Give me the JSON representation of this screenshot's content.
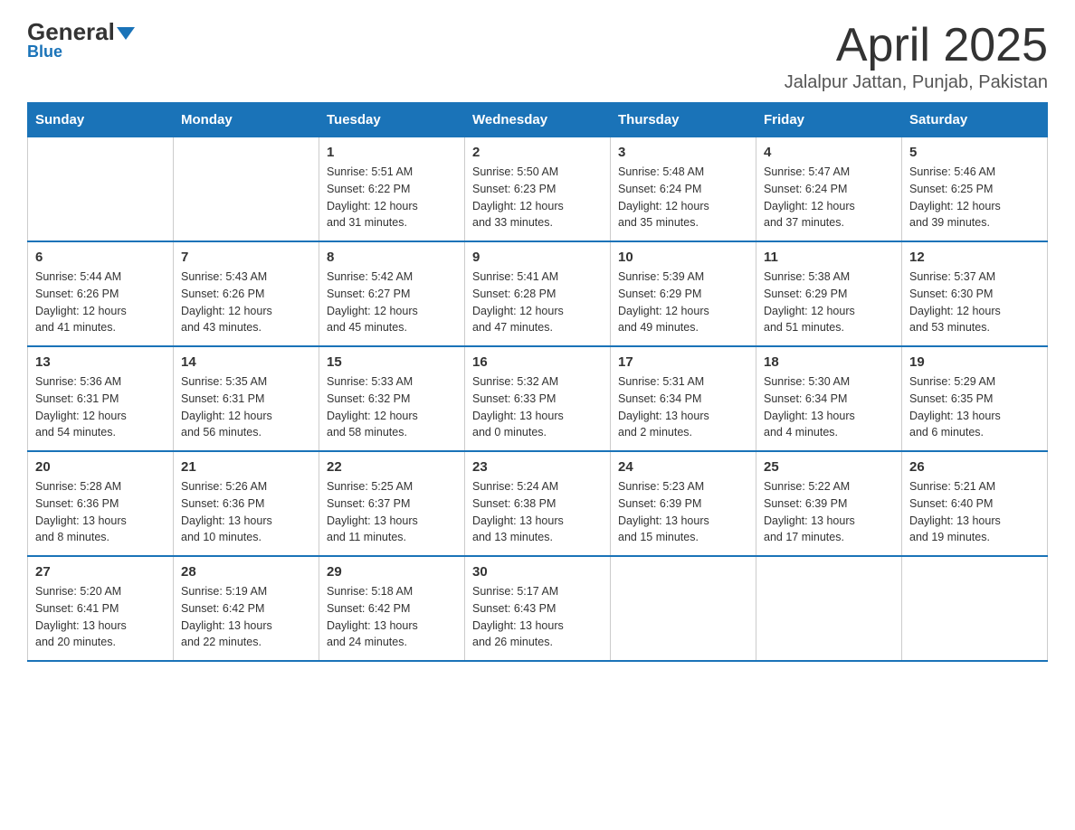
{
  "header": {
    "logo_general": "General",
    "logo_blue": "Blue",
    "month_title": "April 2025",
    "subtitle": "Jalalpur Jattan, Punjab, Pakistan"
  },
  "days_of_week": [
    "Sunday",
    "Monday",
    "Tuesday",
    "Wednesday",
    "Thursday",
    "Friday",
    "Saturday"
  ],
  "weeks": [
    [
      {
        "day": "",
        "info": ""
      },
      {
        "day": "",
        "info": ""
      },
      {
        "day": "1",
        "info": "Sunrise: 5:51 AM\nSunset: 6:22 PM\nDaylight: 12 hours\nand 31 minutes."
      },
      {
        "day": "2",
        "info": "Sunrise: 5:50 AM\nSunset: 6:23 PM\nDaylight: 12 hours\nand 33 minutes."
      },
      {
        "day": "3",
        "info": "Sunrise: 5:48 AM\nSunset: 6:24 PM\nDaylight: 12 hours\nand 35 minutes."
      },
      {
        "day": "4",
        "info": "Sunrise: 5:47 AM\nSunset: 6:24 PM\nDaylight: 12 hours\nand 37 minutes."
      },
      {
        "day": "5",
        "info": "Sunrise: 5:46 AM\nSunset: 6:25 PM\nDaylight: 12 hours\nand 39 minutes."
      }
    ],
    [
      {
        "day": "6",
        "info": "Sunrise: 5:44 AM\nSunset: 6:26 PM\nDaylight: 12 hours\nand 41 minutes."
      },
      {
        "day": "7",
        "info": "Sunrise: 5:43 AM\nSunset: 6:26 PM\nDaylight: 12 hours\nand 43 minutes."
      },
      {
        "day": "8",
        "info": "Sunrise: 5:42 AM\nSunset: 6:27 PM\nDaylight: 12 hours\nand 45 minutes."
      },
      {
        "day": "9",
        "info": "Sunrise: 5:41 AM\nSunset: 6:28 PM\nDaylight: 12 hours\nand 47 minutes."
      },
      {
        "day": "10",
        "info": "Sunrise: 5:39 AM\nSunset: 6:29 PM\nDaylight: 12 hours\nand 49 minutes."
      },
      {
        "day": "11",
        "info": "Sunrise: 5:38 AM\nSunset: 6:29 PM\nDaylight: 12 hours\nand 51 minutes."
      },
      {
        "day": "12",
        "info": "Sunrise: 5:37 AM\nSunset: 6:30 PM\nDaylight: 12 hours\nand 53 minutes."
      }
    ],
    [
      {
        "day": "13",
        "info": "Sunrise: 5:36 AM\nSunset: 6:31 PM\nDaylight: 12 hours\nand 54 minutes."
      },
      {
        "day": "14",
        "info": "Sunrise: 5:35 AM\nSunset: 6:31 PM\nDaylight: 12 hours\nand 56 minutes."
      },
      {
        "day": "15",
        "info": "Sunrise: 5:33 AM\nSunset: 6:32 PM\nDaylight: 12 hours\nand 58 minutes."
      },
      {
        "day": "16",
        "info": "Sunrise: 5:32 AM\nSunset: 6:33 PM\nDaylight: 13 hours\nand 0 minutes."
      },
      {
        "day": "17",
        "info": "Sunrise: 5:31 AM\nSunset: 6:34 PM\nDaylight: 13 hours\nand 2 minutes."
      },
      {
        "day": "18",
        "info": "Sunrise: 5:30 AM\nSunset: 6:34 PM\nDaylight: 13 hours\nand 4 minutes."
      },
      {
        "day": "19",
        "info": "Sunrise: 5:29 AM\nSunset: 6:35 PM\nDaylight: 13 hours\nand 6 minutes."
      }
    ],
    [
      {
        "day": "20",
        "info": "Sunrise: 5:28 AM\nSunset: 6:36 PM\nDaylight: 13 hours\nand 8 minutes."
      },
      {
        "day": "21",
        "info": "Sunrise: 5:26 AM\nSunset: 6:36 PM\nDaylight: 13 hours\nand 10 minutes."
      },
      {
        "day": "22",
        "info": "Sunrise: 5:25 AM\nSunset: 6:37 PM\nDaylight: 13 hours\nand 11 minutes."
      },
      {
        "day": "23",
        "info": "Sunrise: 5:24 AM\nSunset: 6:38 PM\nDaylight: 13 hours\nand 13 minutes."
      },
      {
        "day": "24",
        "info": "Sunrise: 5:23 AM\nSunset: 6:39 PM\nDaylight: 13 hours\nand 15 minutes."
      },
      {
        "day": "25",
        "info": "Sunrise: 5:22 AM\nSunset: 6:39 PM\nDaylight: 13 hours\nand 17 minutes."
      },
      {
        "day": "26",
        "info": "Sunrise: 5:21 AM\nSunset: 6:40 PM\nDaylight: 13 hours\nand 19 minutes."
      }
    ],
    [
      {
        "day": "27",
        "info": "Sunrise: 5:20 AM\nSunset: 6:41 PM\nDaylight: 13 hours\nand 20 minutes."
      },
      {
        "day": "28",
        "info": "Sunrise: 5:19 AM\nSunset: 6:42 PM\nDaylight: 13 hours\nand 22 minutes."
      },
      {
        "day": "29",
        "info": "Sunrise: 5:18 AM\nSunset: 6:42 PM\nDaylight: 13 hours\nand 24 minutes."
      },
      {
        "day": "30",
        "info": "Sunrise: 5:17 AM\nSunset: 6:43 PM\nDaylight: 13 hours\nand 26 minutes."
      },
      {
        "day": "",
        "info": ""
      },
      {
        "day": "",
        "info": ""
      },
      {
        "day": "",
        "info": ""
      }
    ]
  ]
}
